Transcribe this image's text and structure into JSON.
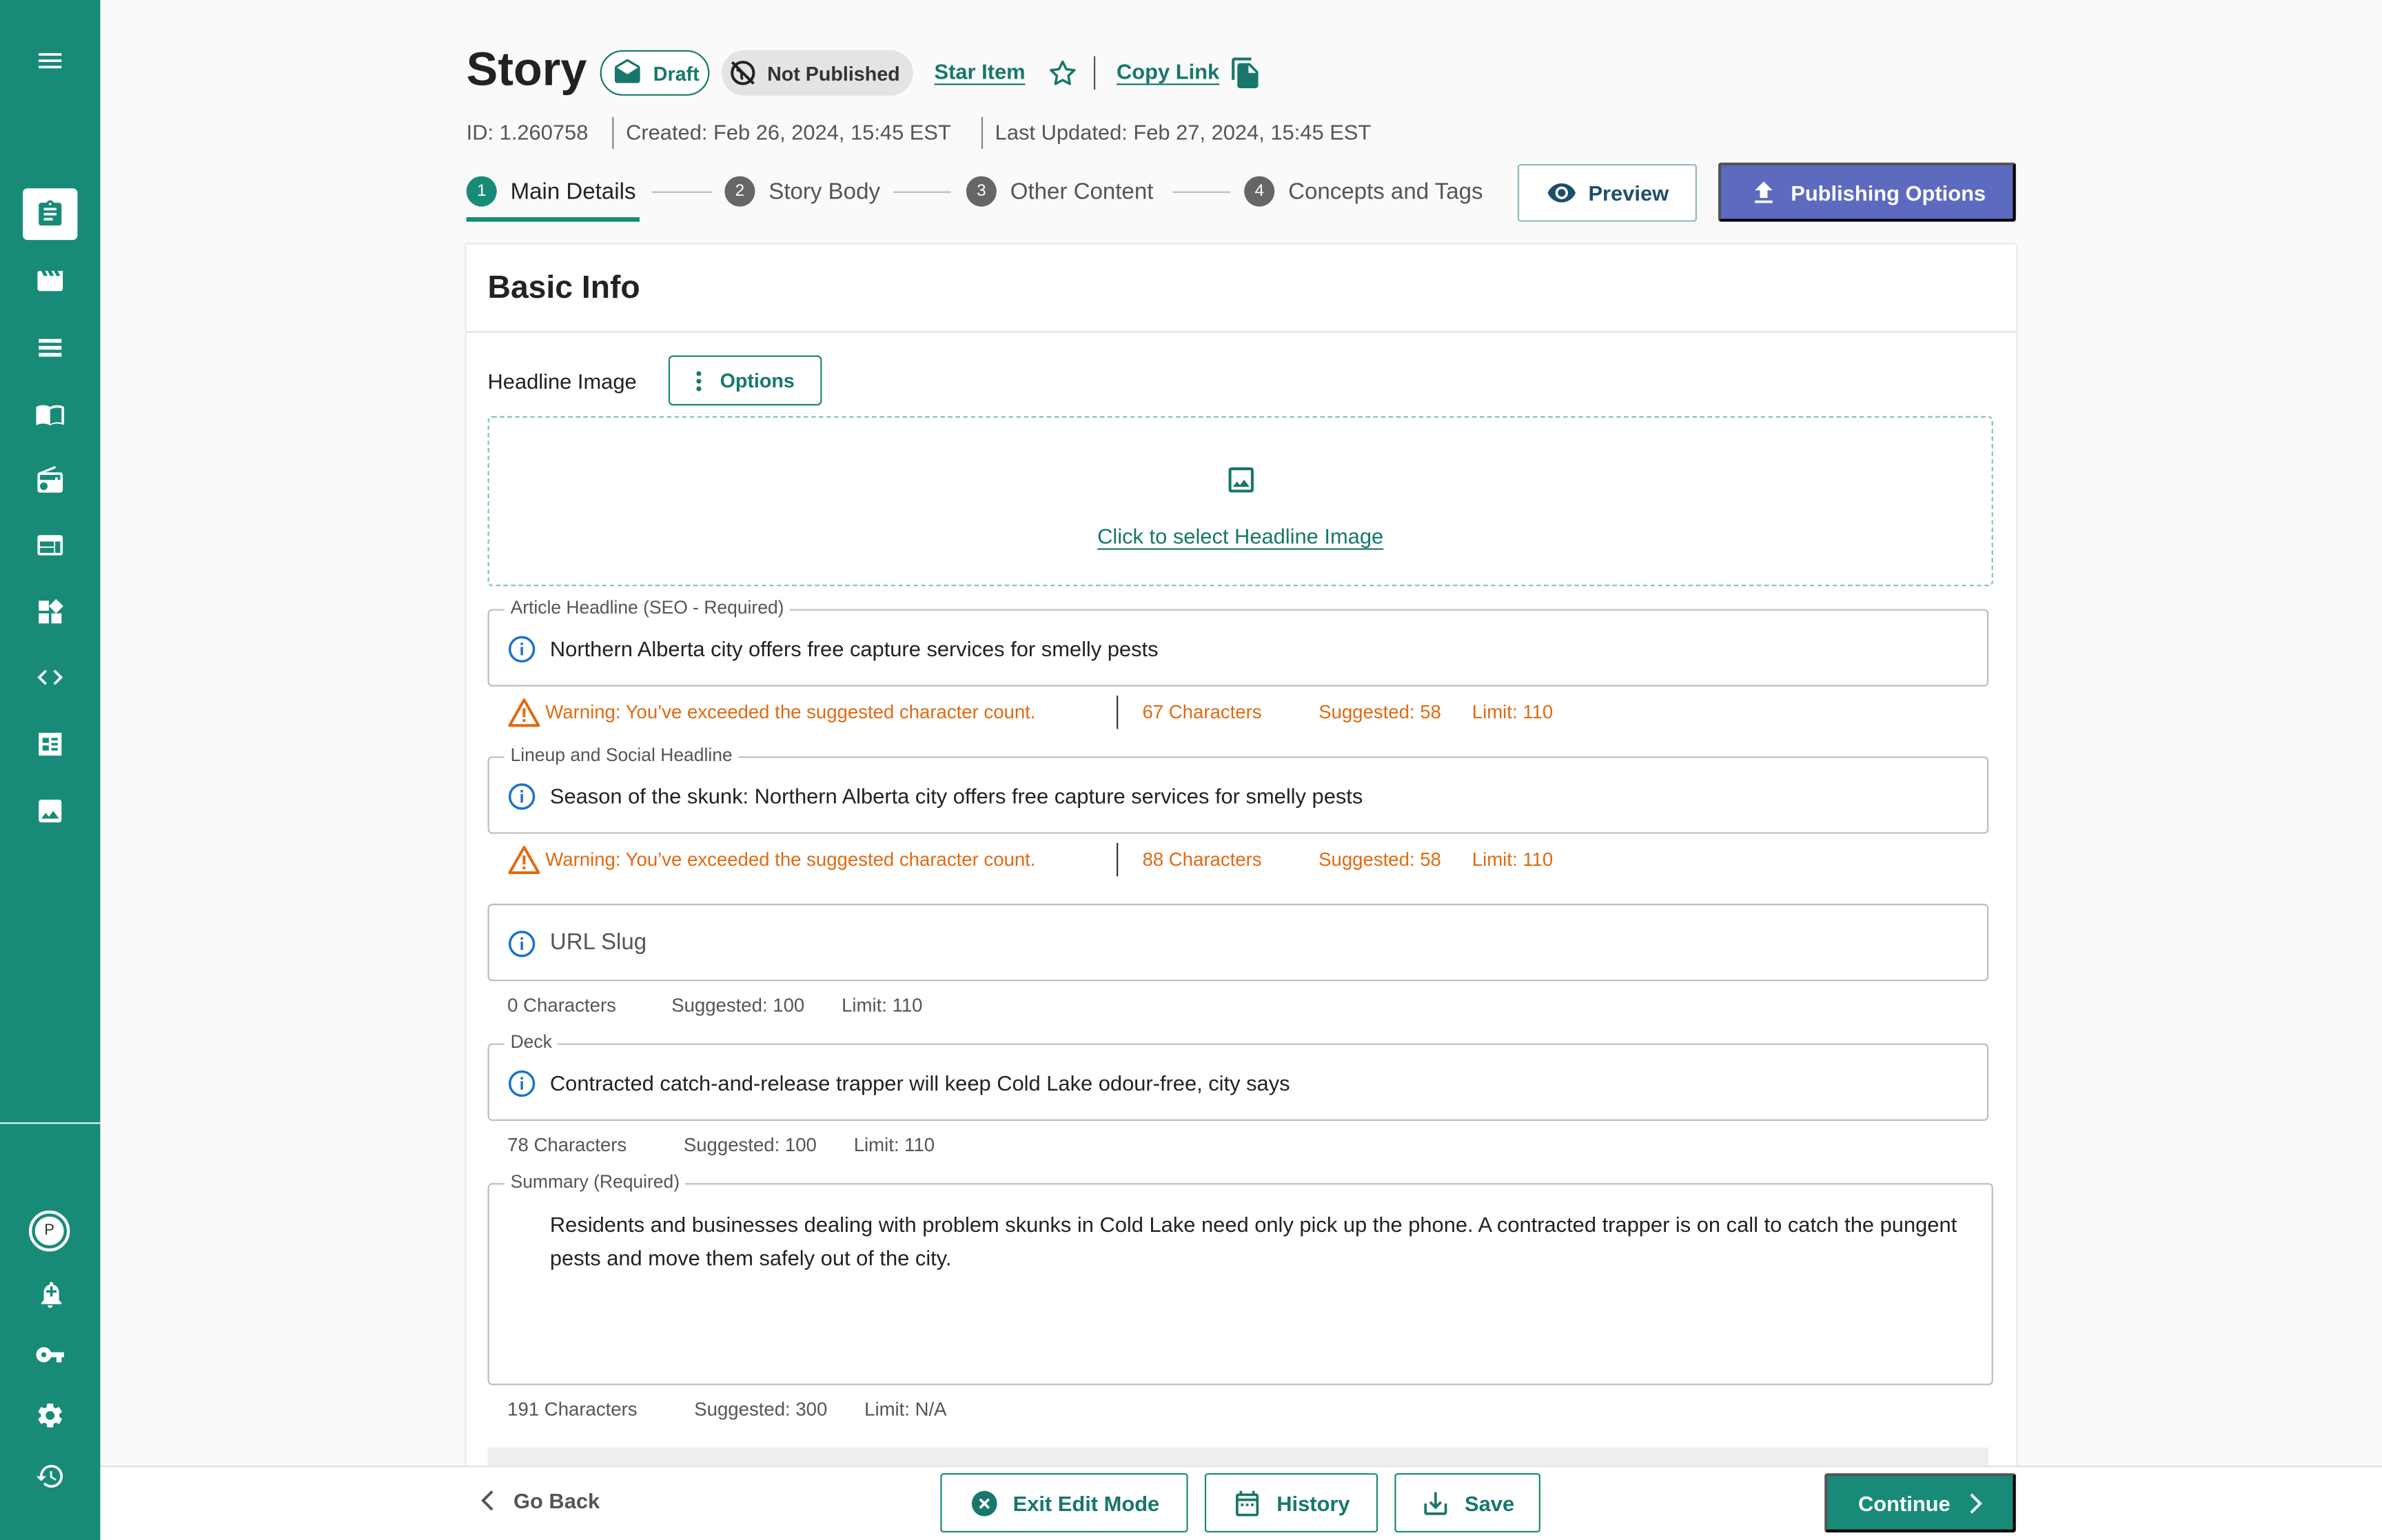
{
  "header": {
    "title": "Story",
    "draft_chip": "Draft",
    "publish_status_chip": "Not Published",
    "star_item_link": "Star Item",
    "copy_link": "Copy Link",
    "id": "ID: 1.260758",
    "created": "Created: Feb 26, 2024, 15:45 EST",
    "updated": "Last Updated: Feb 27, 2024, 15:45 EST"
  },
  "stepper": [
    {
      "num": "1",
      "label": "Main Details",
      "active": true
    },
    {
      "num": "2",
      "label": "Story Body",
      "active": false
    },
    {
      "num": "3",
      "label": "Other Content",
      "active": false
    },
    {
      "num": "4",
      "label": "Concepts and Tags",
      "active": false
    }
  ],
  "actions": {
    "preview": "Preview",
    "publishing_options": "Publishing Options"
  },
  "basic_info": {
    "title": "Basic Info",
    "headline_image_label": "Headline Image",
    "options_button": "Options",
    "select_image_link": "Click to select Headline Image"
  },
  "fields": {
    "article_headline": {
      "label": "Article Headline (SEO - Required)",
      "value": "Northern Alberta city offers free capture services for smelly pests",
      "warning": "Warning: You’ve exceeded the suggested character count.",
      "characters": "67 Characters",
      "suggested": "Suggested: 58",
      "limit": "Limit: 110"
    },
    "lineup_headline": {
      "label": "Lineup and Social Headline",
      "value": "Season of the skunk: Northern Alberta city offers free capture services for smelly pests",
      "warning": "Warning: You’ve exceeded the suggested character count.",
      "characters": "88 Characters",
      "suggested": "Suggested: 58",
      "limit": "Limit: 110"
    },
    "url_slug": {
      "placeholder": "URL Slug",
      "characters": "0 Characters",
      "suggested": "Suggested:  100",
      "limit": "Limit: 110"
    },
    "deck": {
      "label": "Deck",
      "value": "Contracted catch-and-release trapper will keep Cold Lake odour-free, city says",
      "characters": "78 Characters",
      "suggested": "Suggested:  100",
      "limit": "Limit: 110"
    },
    "summary": {
      "label": "Summary (Required)",
      "value": "Residents and businesses dealing with problem skunks in Cold Lake need only pick up the phone. A contracted trapper is on call to catch the pungent pests and move them safely out of the city.",
      "characters": "191 Characters",
      "suggested": "Suggested:  300",
      "limit": "Limit: N/A"
    }
  },
  "footer": {
    "go_back": "Go Back",
    "exit_edit_mode": "Exit Edit Mode",
    "history": "History",
    "save": "Save",
    "continue": "Continue"
  },
  "sidebar": {
    "avatar_initial": "P",
    "icons": [
      "menu-icon",
      "story-icon",
      "video-icon",
      "list-icon",
      "book-icon",
      "radio-icon",
      "web-icon",
      "dashboard-icon",
      "code-icon",
      "checklist-icon",
      "image-icon",
      "notification-add-icon",
      "key-icon",
      "settings-icon",
      "history-icon"
    ]
  },
  "colors": {
    "sidebar": "#178b77",
    "accent": "#17776a",
    "publish_button": "#5c6bc0",
    "warning": "#e06a12",
    "info_icon": "#1a73c8"
  }
}
